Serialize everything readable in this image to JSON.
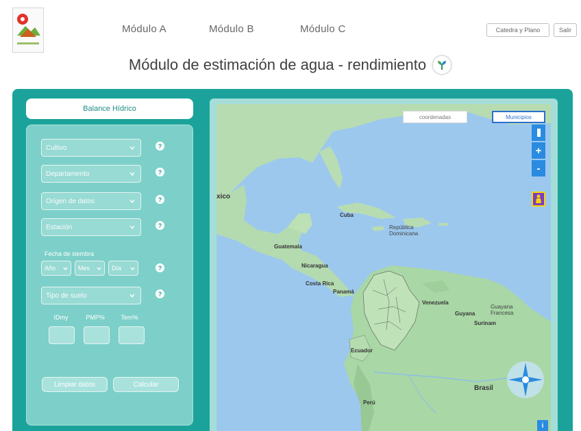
{
  "header": {
    "nav": [
      "Módulo A",
      "Módulo B",
      "Módulo C"
    ],
    "guide_label": "Catedra y Plano",
    "exit_label": "Salir"
  },
  "page": {
    "title": "Módulo de estimación de agua - rendimiento"
  },
  "panel": {
    "tab_label": "Balance Hídrico",
    "selects": [
      "Cultivo",
      "Departamento",
      "Origen de datos",
      "Estación"
    ],
    "sowing_label": "Fecha de siembra",
    "date_selects": [
      "Año",
      "Mes",
      "Día"
    ],
    "soil_select": "Tipo de suelo",
    "inputs": [
      "IDmy",
      "PMP%",
      "Tem%"
    ],
    "clear_label": "Limpiar datos",
    "calc_label": "Calcular",
    "help_glyph": "?"
  },
  "map": {
    "toggle": [
      "coordenadas",
      "Municipios"
    ],
    "zoom_in": "+",
    "zoom_out": "-",
    "info": "i",
    "labels": {
      "mexico": "xico",
      "cuba": "Cuba",
      "rep_dom": "República Dominicana",
      "guatemala": "Guatemala",
      "nicaragua": "Nicaragua",
      "costa_rica": "Costa Rica",
      "panama": "Panamá",
      "venezuela": "Venezuela",
      "guyana": "Guyana",
      "suriname": "Surinam",
      "guayana_fr": "Guayana Francesa",
      "ecuador": "Ecuador",
      "brasil": "Brasil",
      "peru": "Perú"
    }
  },
  "colors": {
    "teal": "#1ba39b",
    "panel": "#7dd0c9",
    "map_blue": "#2a8be0",
    "water": "#9cc8ee",
    "land": "#b7dcb1"
  }
}
